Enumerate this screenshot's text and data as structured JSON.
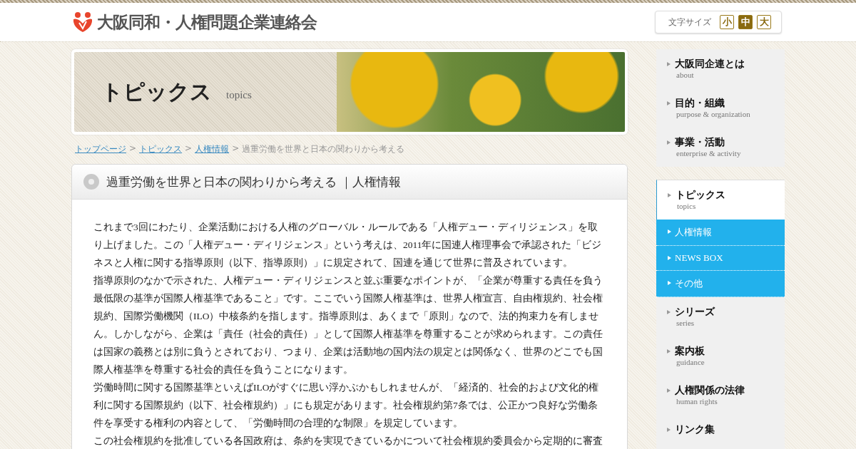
{
  "header": {
    "logo_text": "大阪同和・人権問題企業連絡会",
    "font_size": {
      "label": "文字サイズ",
      "options": [
        {
          "label": "小",
          "selected": false
        },
        {
          "label": "中",
          "selected": true
        },
        {
          "label": "大",
          "selected": false
        }
      ]
    }
  },
  "banner": {
    "title": "トピックス",
    "subtitle": "topics"
  },
  "breadcrumb": [
    {
      "label": "トップページ",
      "kind": "link"
    },
    {
      "label": ">",
      "kind": "separator"
    },
    {
      "label": "トピックス",
      "kind": "link"
    },
    {
      "label": ">",
      "kind": "separator"
    },
    {
      "label": "人権情報",
      "kind": "link"
    },
    {
      "label": ">",
      "kind": "separator"
    },
    {
      "label": "過重労働を世界と日本の関わりから考える",
      "kind": "current"
    }
  ],
  "article": {
    "title": "過重労働を世界と日本の関わりから考える ｜人権情報",
    "paragraphs": [
      "これまで3回にわたり、企業活動における人権のグローバル・ルールである「人権デュー・ディリジェンス」を取り上げました。この「人権デュー・ディリジェンス」という考えは、2011年に国連人権理事会で承認された「ビジネスと人権に関する指導原則（以下、指導原則）」に規定されて、国連を通じて世界に普及されています。",
      "指導原則のなかで示された、人権デュー・ディリジェンスと並ぶ重要なポイントが、「企業が尊重する責任を負う最低限の基準が国際人権基準であること」です。ここでいう国際人権基準は、世界人権宣言、自由権規約、社会権規約、国際労働機関（ILO）中核条約を指します。指導原則は、あくまで「原則」なので、法的拘束力を有しません。しかしながら、企業は「責任（社会的責任）」として国際人権基準を尊重することが求められます。この責任は国家の義務とは別に負うとされており、つまり、企業は活動地の国内法の規定とは関係なく、世界のどこでも国際人権基準を尊重する社会的責任を負うことになります。",
      "労働時間に関する国際基準といえばILOがすぐに思い浮かぶかもしれませんが、「経済的、社会的および文化的権利に関する国際規約（以下、社会権規約）」にも規定があります。社会権規約第7条では、公正かつ良好な労働条件を享受する権利の内容として、「労働時間の合理的な制限」を規定しています。",
      "この社会権規約を批准している各国政府は、条約を実現できているかについて社会権規約委員会から定期的に審査"
    ]
  },
  "sidebar": {
    "items": [
      {
        "kind": "main",
        "label": "大阪同企連とは",
        "sublabel": "about",
        "selected": false
      },
      {
        "kind": "main",
        "label": "目的・組織",
        "sublabel": "purpose & organization",
        "selected": false
      },
      {
        "kind": "main",
        "label": "事業・活動",
        "sublabel": "enterprise & activity",
        "selected": false
      },
      {
        "kind": "main",
        "label": "トピックス",
        "sublabel": "topics",
        "selected": true
      },
      {
        "kind": "sub",
        "label": "人権情報",
        "selected": false
      },
      {
        "kind": "sub",
        "label": "NEWS BOX",
        "selected": false
      },
      {
        "kind": "sub",
        "label": "その他",
        "selected": false
      },
      {
        "kind": "main",
        "label": "シリーズ",
        "sublabel": "series",
        "selected": false
      },
      {
        "kind": "main",
        "label": "案内板",
        "sublabel": "guidance",
        "selected": false
      },
      {
        "kind": "main",
        "label": "人権関係の法律",
        "sublabel": "human rights",
        "selected": false
      },
      {
        "kind": "main",
        "label": "リンク集",
        "selected": false
      }
    ]
  }
}
